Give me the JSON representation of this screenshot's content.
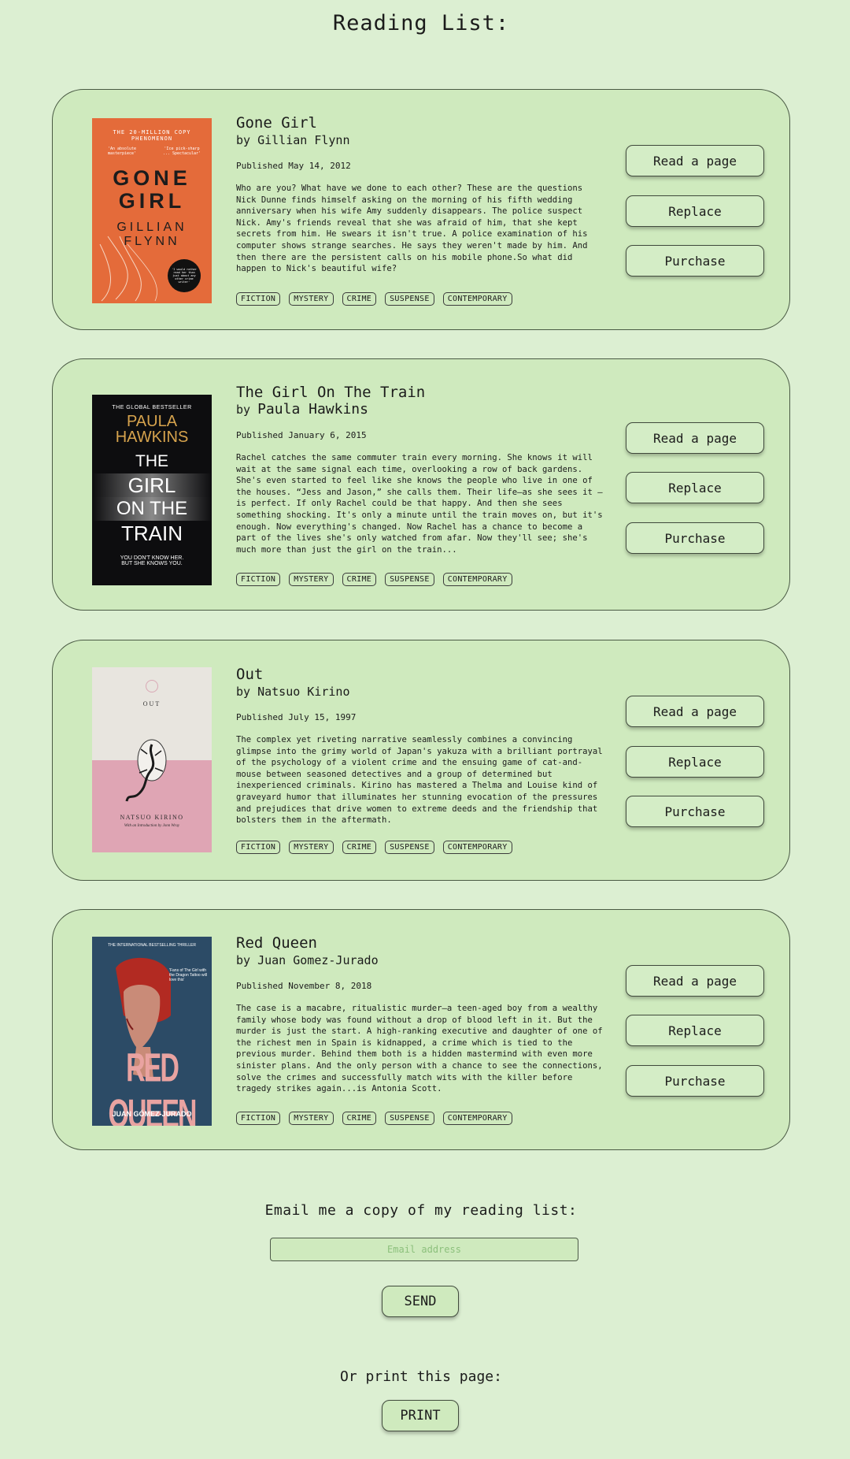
{
  "page": {
    "title": "Reading List:"
  },
  "books": [
    {
      "title": "Gone Girl",
      "author_prefix": "by",
      "author": "Gillian Flynn",
      "published": "Published May 14, 2012",
      "description": "Who are you? What have we done to each other? These are the questions Nick Dunne finds himself asking on the morning of his fifth wedding anniversary when his wife Amy suddenly disappears. The police suspect Nick. Amy's friends reveal that she was afraid of him, that she kept secrets from him. He swears it isn't true. A police examination of his computer shows strange searches. He says they weren't made by him. And then there are the persistent calls on his mobile phone.So what did happen to Nick's beautiful wife?",
      "tags": [
        "FICTION",
        "MYSTERY",
        "CRIME",
        "SUSPENSE",
        "CONTEMPORARY"
      ],
      "cover": {
        "line1": "THE 20-MILLION COPY",
        "line2": "PHENOMENON",
        "quote_left": "'An absolute masterpiece'",
        "quote_right": "'Ice pick-sharp ... Spectacular'",
        "title_l1": "GONE",
        "title_l2": "GIRL",
        "author_l1": "GILLIAN",
        "author_l2": "FLYNN",
        "badge": "'I would rather read her than just about any other crime writer'"
      }
    },
    {
      "title": "The Girl On The Train",
      "author_prefix": "by",
      "author": "Paula Hawkins",
      "published": "Published January 6, 2015",
      "description": "Rachel catches the same commuter train every morning. She knows it will wait at the same signal each time, overlooking a row of back gardens. She's even started to feel like she knows the people who live in one of the houses. “Jess and Jason,” she calls them. Their life—as she sees it —is perfect. If only Rachel could be that happy. And then she sees something shocking. It's only a minute until the train moves on, but it's enough. Now everything's changed. Now Rachel has a chance to become a part of the lives she's only watched from afar. Now they'll see; she's much more than just the girl on the train...",
      "tags": [
        "FICTION",
        "MYSTERY",
        "CRIME",
        "SUSPENSE",
        "CONTEMPORARY"
      ],
      "cover": {
        "line1": "THE GLOBAL BESTSELLER",
        "author_l1": "PAULA",
        "author_l2": "HAWKINS",
        "title_l1": "THE",
        "title_l2": "GIRL",
        "title_l3": "ON THE",
        "title_l4": "TRAIN",
        "tag_l1": "YOU DON'T KNOW HER.",
        "tag_l2": "BUT SHE KNOWS YOU."
      }
    },
    {
      "title": "Out",
      "author_prefix": "by",
      "author": "Natsuo Kirino",
      "published": "Published July 15, 1997",
      "description": "The complex yet riveting narrative seamlessly combines a convincing glimpse into the grimy world of Japan's yakuza with a brilliant portrayal of the psychology of a violent crime and the ensuing game of cat-and-mouse between seasoned detectives and a group of determined but inexperienced criminals. Kirino has mastered a Thelma and Louise kind of graveyard humor that illuminates her stunning evocation of the pressures and prejudices that drive women to extreme deeds and the friendship that bolsters them in the aftermath.",
      "tags": [
        "FICTION",
        "MYSTERY",
        "CRIME",
        "SUSPENSE",
        "CONTEMPORARY"
      ],
      "cover": {
        "title": "OUT",
        "author": "NATSUO KIRINO",
        "intro": "With an Introduction by Jonn Wray"
      }
    },
    {
      "title": "Red Queen",
      "author_prefix": "by",
      "author": "Juan Gomez-Jurado",
      "published": "Published November 8, 2018",
      "description": "The case is a macabre, ritualistic murder—a teen-aged boy from a wealthy family whose body was found without a drop of blood left in it. But the murder is just the start. A high-ranking executive and daughter of one of the richest men in Spain is kidnapped, a crime which is tied to the previous murder. Behind them both is a hidden mastermind with even more sinister plans. And the only person with a chance to see the connections, solve the crimes and successfully match wits with the killer before tragedy strikes again...is Antonia Scott.",
      "tags": [
        "FICTION",
        "MYSTERY",
        "CRIME",
        "SUSPENSE",
        "CONTEMPORARY"
      ],
      "cover": {
        "line1": "THE INTERNATIONAL BESTSELLING THRILLER",
        "blurb": "'Fans of The Girl with the Dragon Tattoo will love this'",
        "title": "RED QUEEN",
        "author": "JUAN GÓMEZ-JURADO"
      }
    }
  ],
  "actions": {
    "read_label": "Read a page",
    "replace_label": "Replace",
    "purchase_label": "Purchase"
  },
  "email": {
    "title": "Email me a copy of my reading list:",
    "placeholder": "Email address",
    "send_label": "SEND"
  },
  "print": {
    "title": "Or print this page:",
    "print_label": "PRINT"
  }
}
